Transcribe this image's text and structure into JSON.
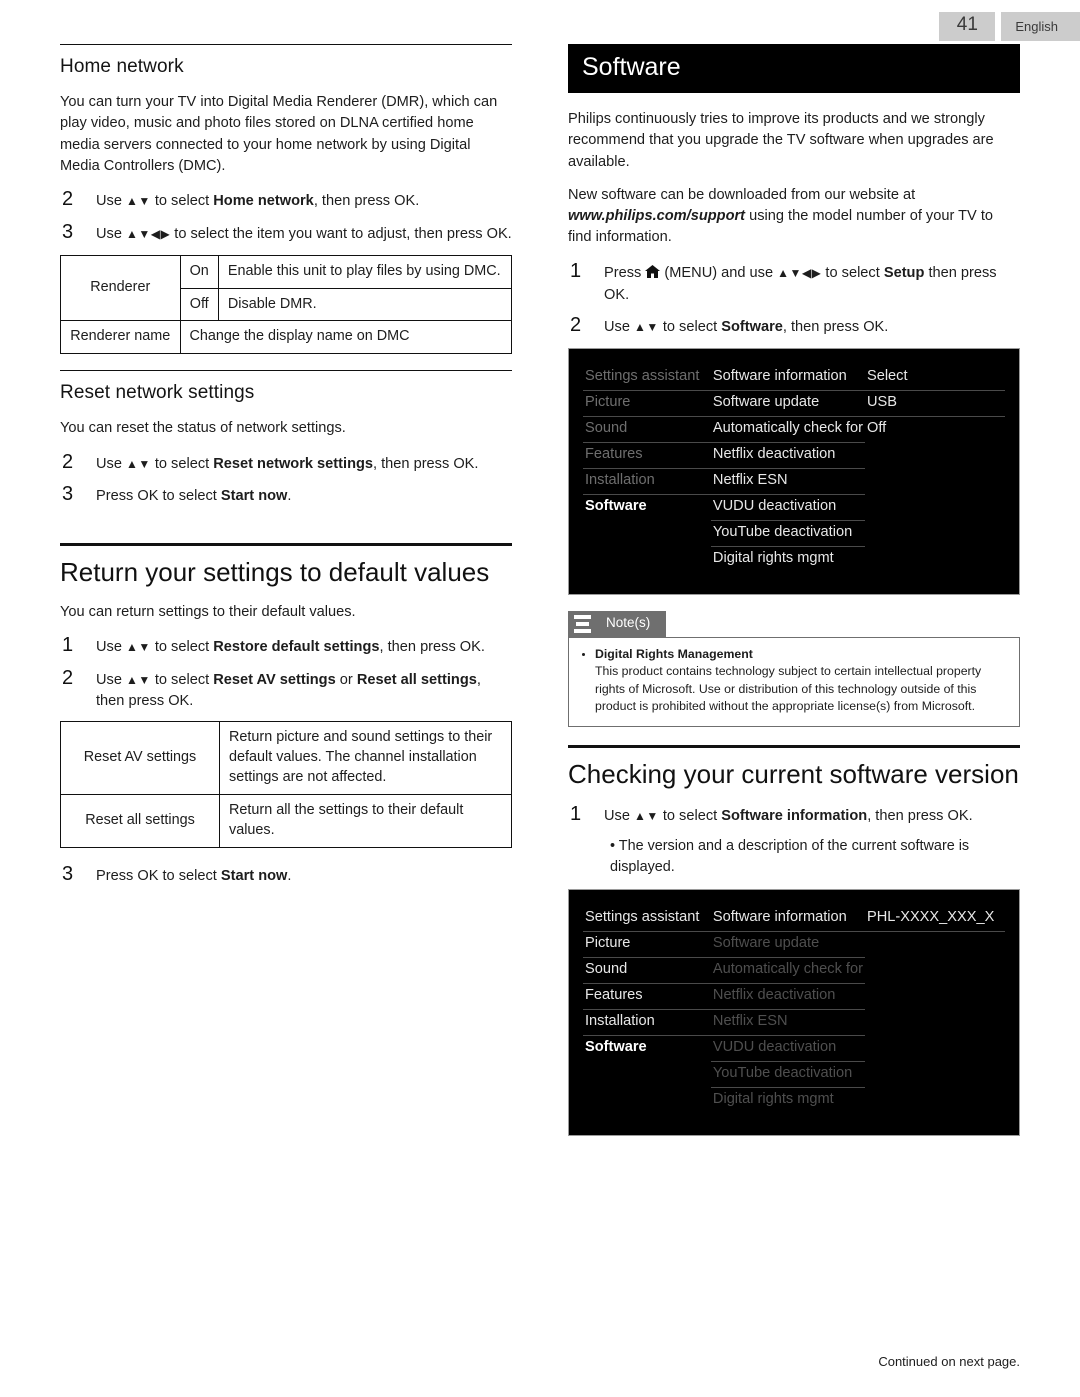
{
  "header": {
    "page_number": "41",
    "language": "English"
  },
  "footer": {
    "continued": "Continued on next page."
  },
  "left_column": {
    "home_network": {
      "heading": "Home network",
      "paragraph": "You can turn your TV into Digital Media Renderer (DMR), which can play video, music and photo files stored on DLNA certified home media servers connected to your home network by using Digital Media Controllers (DMC).",
      "steps": [
        {
          "num": "2",
          "pre": "Use ",
          "arrows": "▲▼",
          "mid": " to select ",
          "bold": "Home network",
          "post": ", then press OK."
        },
        {
          "num": "3",
          "pre": "Use ",
          "arrows": "▲▼◀▶",
          "mid": " to select the item you want to adjust, then press OK.",
          "bold": "",
          "post": ""
        }
      ],
      "table": {
        "rows": [
          {
            "key": "Renderer",
            "value": "On",
            "desc": "Enable this unit to play files by using DMC."
          },
          {
            "key": "",
            "value": "Off",
            "desc": "Disable DMR."
          },
          {
            "key": "Renderer name",
            "value": "",
            "desc": "Change the display name on DMC"
          }
        ]
      }
    },
    "reset_network": {
      "heading": "Reset network settings",
      "paragraph": "You can reset the status of network settings.",
      "steps": [
        {
          "num": "2",
          "pre": "Use ",
          "arrows": "▲▼",
          "mid": " to select ",
          "bold": "Reset network settings",
          "post": ", then press OK."
        },
        {
          "num": "3",
          "pre": "Press OK to select ",
          "arrows": "",
          "mid": "",
          "bold": "Start now",
          "post": "."
        }
      ]
    },
    "return_defaults": {
      "heading": "Return your settings to default values",
      "paragraph": "You can return settings to their default values.",
      "steps": [
        {
          "num": "1",
          "pre": "Use ",
          "arrows": "▲▼",
          "mid": " to select ",
          "bold": "Restore default settings",
          "post": ", then press OK."
        },
        {
          "num": "2",
          "pre": "Use ",
          "arrows": "▲▼",
          "mid": " to select ",
          "bold": "Reset AV settings",
          "bold2": "Reset all settings",
          "mid2": " or ",
          "post": ", then press OK."
        }
      ],
      "table": {
        "rows": [
          {
            "key": "Reset AV settings",
            "desc": "Return picture and sound settings to their default values. The channel installation settings are not affected."
          },
          {
            "key": "Reset all settings",
            "desc": "Return all the settings to their default values."
          }
        ]
      },
      "final_step": {
        "num": "3",
        "pre": "Press OK to select ",
        "bold": "Start now",
        "post": "."
      }
    }
  },
  "right_column": {
    "software": {
      "banner": "Software",
      "paragraph1": "Philips continuously tries to improve its products and we strongly recommend that you upgrade the TV software when upgrades are available.",
      "paragraph2_pre": "New software can be downloaded from our website at ",
      "paragraph2_link": "www.philips.com/support",
      "paragraph2_post": " using the model number of your TV to find information.",
      "steps": [
        {
          "num": "1",
          "pre": "Press ",
          "icon": "home-icon",
          "mid": " (MENU) and use ",
          "arrows": "▲▼◀▶",
          "mid2": " to select ",
          "bold": "Setup",
          "post": " then press OK."
        },
        {
          "num": "2",
          "pre": "Use ",
          "arrows": "▲▼",
          "mid": " to select ",
          "bold": "Software",
          "post": ", then press OK."
        }
      ]
    },
    "tv_menu_1": {
      "col1": [
        "Settings assistant",
        "Picture",
        "Sound",
        "Features",
        "Installation",
        "Software"
      ],
      "col1_selected": "Software",
      "col2": [
        "Software information",
        "Software update",
        "Automatically check for",
        "Netflix deactivation",
        "Netflix ESN",
        "VUDU deactivation",
        "YouTube deactivation",
        "Digital rights mgmt"
      ],
      "col3": [
        "Select",
        "USB",
        "Off"
      ]
    },
    "notes": {
      "label": "Note(s)",
      "title": "Digital Rights Management",
      "text": "This product contains technology subject to certain intellectual property rights of Microsoft. Use or distribution of this technology outside of this product is prohibited without the appropriate license(s) from Microsoft."
    },
    "checking_version": {
      "heading": "Checking your current software version",
      "step": {
        "num": "1",
        "pre": "Use ",
        "arrows": "▲▼",
        "mid": " to select ",
        "bold": "Software information",
        "post": ", then press OK."
      },
      "bullet": "• The version and a description of the current software is displayed."
    },
    "tv_menu_2": {
      "col1": [
        "Settings assistant",
        "Picture",
        "Sound",
        "Features",
        "Installation",
        "Software"
      ],
      "col1_selected": "Software",
      "col2": [
        "Software information",
        "Software update",
        "Automatically check for",
        "Netflix deactivation",
        "Netflix ESN",
        "VUDU deactivation",
        "YouTube deactivation",
        "Digital rights mgmt"
      ],
      "col2_highlight": "Software information",
      "col3": [
        "PHL-XXXX_XXX_X"
      ]
    }
  },
  "colors": {
    "banner_bg": "#000000",
    "tag_bg": "#cccccc",
    "note_gray": "#6f6f6f"
  }
}
